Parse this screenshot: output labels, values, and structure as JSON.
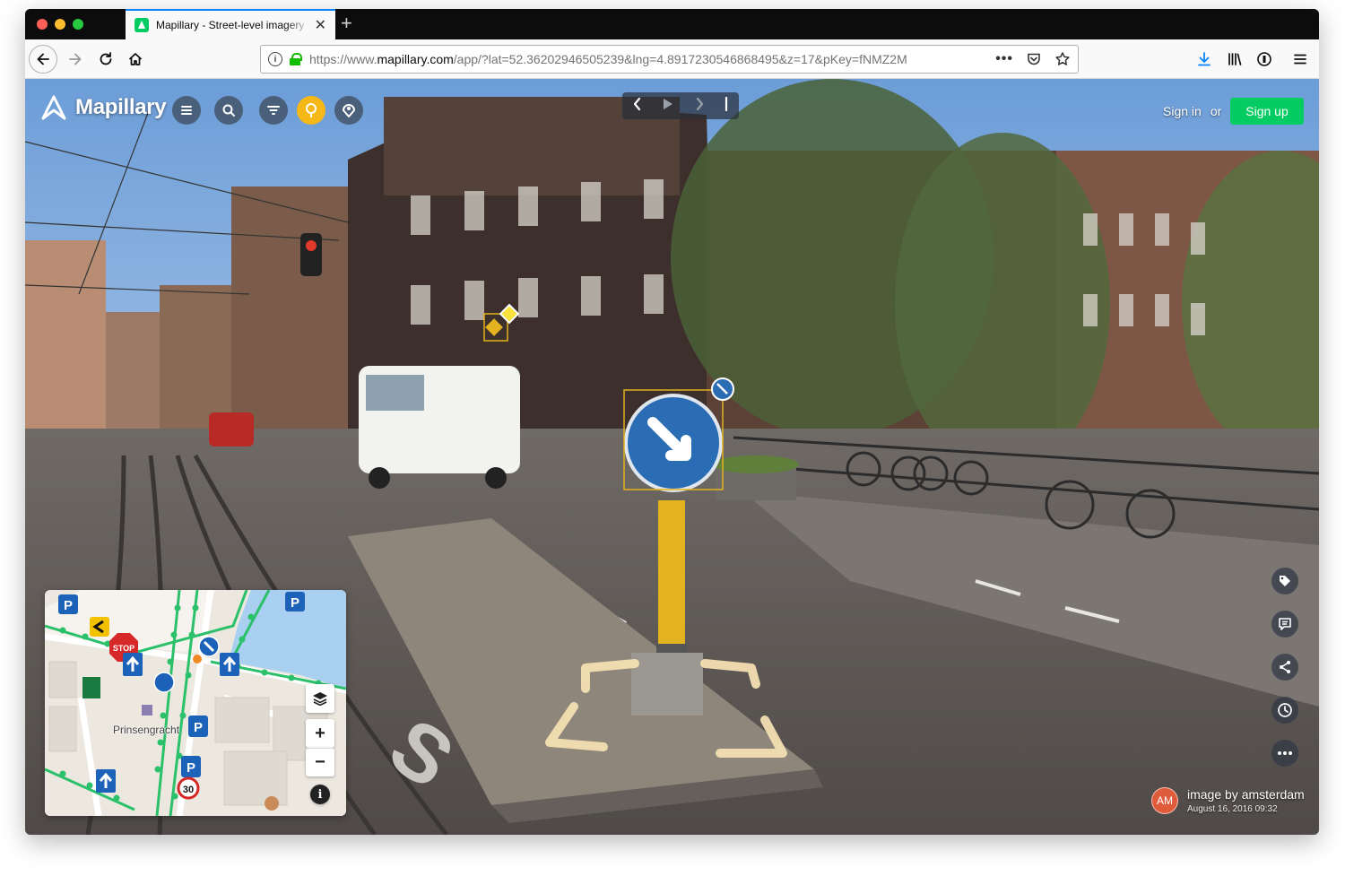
{
  "browser": {
    "tab_title": "Mapillary - Street-level imagery",
    "tab_close": "✕",
    "new_tab": "+",
    "url_prefix": "https://www.",
    "url_host": "mapillary.com",
    "url_path": "/app/?lat=52.36202946505239&lng=4.8917230546868495&z=17&pKey=fNMZ2M",
    "icons": [
      "back-arrow-icon",
      "forward-arrow-icon",
      "reload-icon",
      "home-icon",
      "info-icon",
      "lock-icon",
      "more-icon",
      "pocket-icon",
      "star-icon",
      "download-icon",
      "library-icon",
      "shield-icon",
      "menu-icon"
    ]
  },
  "app": {
    "brand": "Mapillary",
    "sign_in": "Sign in",
    "or": "or",
    "sign_up": "Sign up",
    "accent": "#05cb63",
    "attribution": {
      "initials": "AM",
      "byline": "image by amsterdam",
      "date": "August 16, 2016 09:32"
    }
  },
  "minimap": {
    "street_label": "Prinsengracht",
    "zoom_in": "+",
    "zoom_out": "−",
    "speed_sign": "30"
  }
}
